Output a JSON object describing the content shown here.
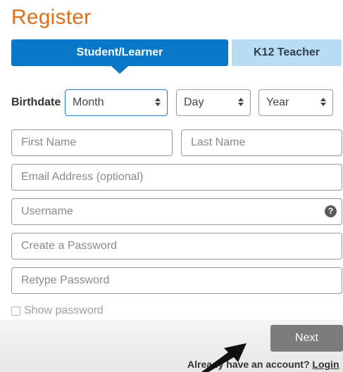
{
  "page": {
    "title": "Register"
  },
  "tabs": {
    "student_label": "Student/Learner",
    "teacher_label": "K12 Teacher"
  },
  "birthdate": {
    "label": "Birthdate",
    "month": "Month",
    "day": "Day",
    "year": "Year"
  },
  "fields": {
    "first_name_placeholder": "First Name",
    "last_name_placeholder": "Last Name",
    "email_placeholder": "Email Address (optional)",
    "username_placeholder": "Username",
    "password_placeholder": "Create a Password",
    "retype_placeholder": "Retype Password",
    "help_glyph": "?"
  },
  "show_password": {
    "label": "Show password",
    "checked": false
  },
  "actions": {
    "next_label": "Next",
    "already_text": "Already have an account?",
    "login_label": "Login"
  },
  "colors": {
    "title": "#d9701f",
    "tab_active": "#0a78c8",
    "tab_inactive": "#b9dcf3",
    "next_button": "#7c7c7c"
  },
  "icons": {
    "help": "question-circle-icon",
    "select_arrows": "up-down-chevron-icon",
    "pointer": "black-arrow-annotation-icon"
  }
}
